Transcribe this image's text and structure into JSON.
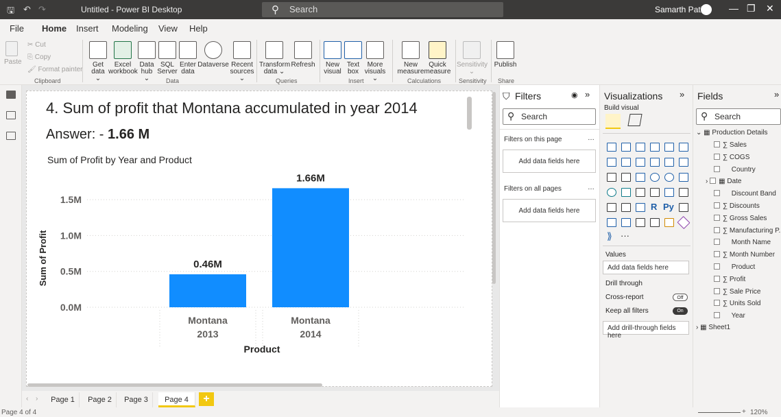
{
  "titlebar": {
    "title": "Untitled - Power BI Desktop",
    "search": "Search",
    "user": "Samarth Patil"
  },
  "menu": [
    "File",
    "Home",
    "Insert",
    "Modeling",
    "View",
    "Help"
  ],
  "ribbon": {
    "clipboard": {
      "paste": "Paste",
      "cut": "Cut",
      "copy": "Copy",
      "format_painter": "Format painter",
      "label": "Clipboard"
    },
    "data": {
      "buttons": [
        {
          "l1": "Get",
          "l2": "data ⌄"
        },
        {
          "l1": "Excel",
          "l2": "workbook"
        },
        {
          "l1": "Data",
          "l2": "hub ⌄"
        },
        {
          "l1": "SQL",
          "l2": "Server"
        },
        {
          "l1": "Enter",
          "l2": "data"
        },
        {
          "l1": "Dataverse",
          "l2": ""
        },
        {
          "l1": "Recent",
          "l2": "sources ⌄"
        }
      ],
      "label": "Data"
    },
    "queries": {
      "buttons": [
        {
          "l1": "Transform",
          "l2": "data ⌄"
        },
        {
          "l1": "Refresh",
          "l2": ""
        }
      ],
      "label": "Queries"
    },
    "insert": {
      "buttons": [
        {
          "l1": "New",
          "l2": "visual"
        },
        {
          "l1": "Text",
          "l2": "box"
        },
        {
          "l1": "More",
          "l2": "visuals ⌄"
        }
      ],
      "label": "Insert"
    },
    "calculations": {
      "buttons": [
        {
          "l1": "New",
          "l2": "measure"
        },
        {
          "l1": "Quick",
          "l2": "measure"
        }
      ],
      "label": "Calculations"
    },
    "sensitivity": {
      "button": "Sensitivity",
      "label": "Sensitivity"
    },
    "share": {
      "button": "Publish",
      "label": "Share"
    }
  },
  "report": {
    "question": "4. Sum of profit that Montana accumulated in year 2014",
    "answer_prefix": "Answer: - ",
    "answer_value": "1.66 M"
  },
  "chart_data": {
    "type": "bar",
    "title": "Sum of Profit by Year and Product",
    "xlabel": "Product",
    "ylabel": "Sum of Profit",
    "categories": [
      [
        "Montana",
        "2013"
      ],
      [
        "Montana",
        "2014"
      ]
    ],
    "values": [
      0.46,
      1.66
    ],
    "data_labels": [
      "0.46M",
      "1.66M"
    ],
    "yticks": [
      "0.0M",
      "0.5M",
      "1.0M",
      "1.5M"
    ],
    "ytick_values": [
      0,
      0.5,
      1.0,
      1.5
    ],
    "ylim": [
      0,
      1.75
    ],
    "grid": true,
    "color": "#118dff"
  },
  "pages": {
    "tabs": [
      "Page 1",
      "Page 2",
      "Page 3",
      "Page 4"
    ],
    "active": "Page 4",
    "add": "+"
  },
  "status": {
    "page_info": "Page 4 of 4",
    "zoom": "120%"
  },
  "filters": {
    "title": "Filters",
    "search": "Search",
    "on_this_page": "Filters on this page",
    "on_all_pages": "Filters on all pages",
    "add_here": "Add data fields here"
  },
  "visualizations": {
    "title": "Visualizations",
    "build_visual": "Build visual",
    "values": "Values",
    "add_fields": "Add data fields here",
    "drill_through": "Drill through",
    "cross_report": "Cross-report",
    "cross_state": "Off",
    "keep_all": "Keep all filters",
    "keep_state": "On",
    "add_drill": "Add drill-through fields here",
    "more": "···",
    "r_label": "R",
    "py_label": "Py"
  },
  "fields": {
    "title": "Fields",
    "search": "Search",
    "table": "Production Details",
    "items": [
      {
        "name": "Sales",
        "sigma": true
      },
      {
        "name": "COGS",
        "sigma": true
      },
      {
        "name": "Country",
        "sigma": false
      },
      {
        "name": "Date",
        "sigma": false,
        "date": true
      },
      {
        "name": "Discount Band",
        "sigma": false
      },
      {
        "name": "Discounts",
        "sigma": true
      },
      {
        "name": "Gross Sales",
        "sigma": true
      },
      {
        "name": "Manufacturing P...",
        "sigma": true
      },
      {
        "name": "Month Name",
        "sigma": false
      },
      {
        "name": "Month Number",
        "sigma": true
      },
      {
        "name": "Product",
        "sigma": false
      },
      {
        "name": "Profit",
        "sigma": true
      },
      {
        "name": "Sale Price",
        "sigma": true
      },
      {
        "name": "Units Sold",
        "sigma": true
      },
      {
        "name": "Year",
        "sigma": false
      }
    ],
    "sheet": "Sheet1"
  }
}
